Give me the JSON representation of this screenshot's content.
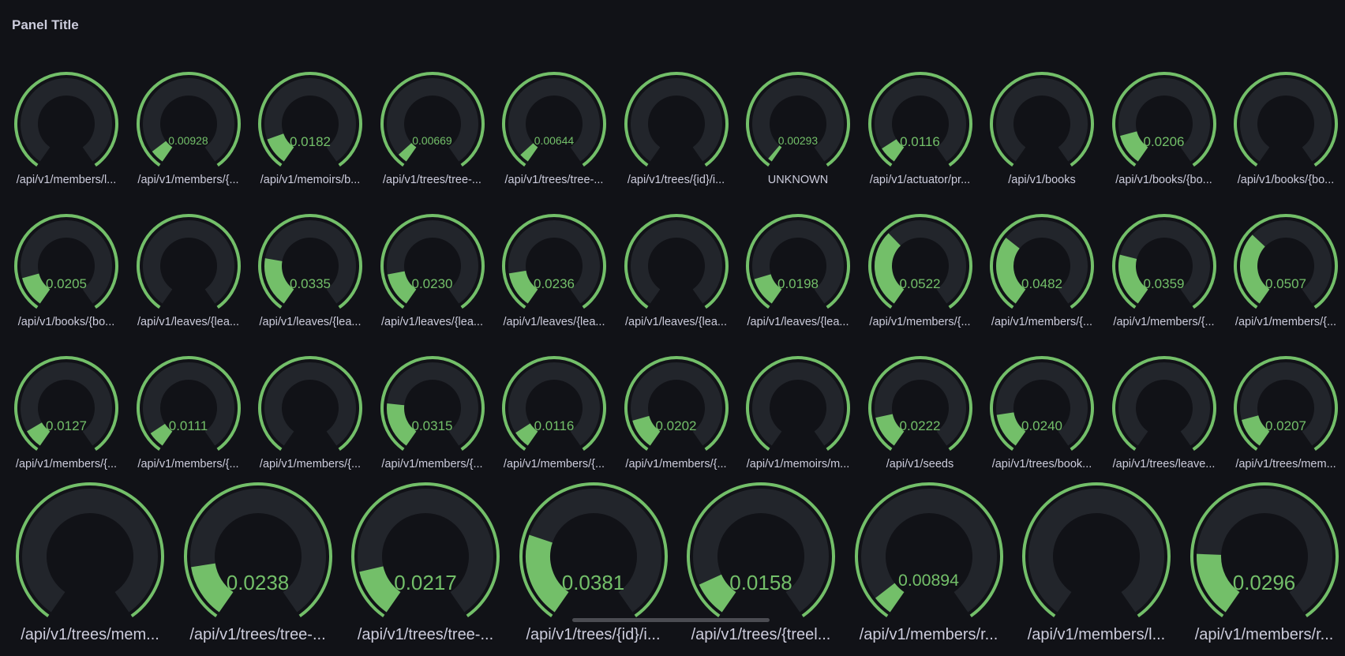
{
  "panel": {
    "title": "Panel Title"
  },
  "colors": {
    "background": "#111217",
    "track": "#22252b",
    "threshold": "#73bf69",
    "value": "#73bf69",
    "label": "#ccccdc"
  },
  "gauge_max": 0.15,
  "rows": [
    [
      {
        "label": "/api/v1/members/l...",
        "value": ""
      },
      {
        "label": "/api/v1/members/{...",
        "value": "0.00928"
      },
      {
        "label": "/api/v1/memoirs/b...",
        "value": "0.0182"
      },
      {
        "label": "/api/v1/trees/tree-...",
        "value": "0.00669"
      },
      {
        "label": "/api/v1/trees/tree-...",
        "value": "0.00644"
      },
      {
        "label": "/api/v1/trees/{id}/i...",
        "value": ""
      },
      {
        "label": "UNKNOWN",
        "value": "0.00293"
      },
      {
        "label": "/api/v1/actuator/pr...",
        "value": "0.0116"
      },
      {
        "label": "/api/v1/books",
        "value": ""
      },
      {
        "label": "/api/v1/books/{bo...",
        "value": "0.0206"
      },
      {
        "label": "/api/v1/books/{bo...",
        "value": ""
      }
    ],
    [
      {
        "label": "/api/v1/books/{bo...",
        "value": "0.0205"
      },
      {
        "label": "/api/v1/leaves/{lea...",
        "value": ""
      },
      {
        "label": "/api/v1/leaves/{lea...",
        "value": "0.0335"
      },
      {
        "label": "/api/v1/leaves/{lea...",
        "value": "0.0230"
      },
      {
        "label": "/api/v1/leaves/{lea...",
        "value": "0.0236"
      },
      {
        "label": "/api/v1/leaves/{lea...",
        "value": ""
      },
      {
        "label": "/api/v1/leaves/{lea...",
        "value": "0.0198"
      },
      {
        "label": "/api/v1/members/{...",
        "value": "0.0522"
      },
      {
        "label": "/api/v1/members/{...",
        "value": "0.0482"
      },
      {
        "label": "/api/v1/members/{...",
        "value": "0.0359"
      },
      {
        "label": "/api/v1/members/{...",
        "value": "0.0507"
      }
    ],
    [
      {
        "label": "/api/v1/members/{...",
        "value": "0.0127"
      },
      {
        "label": "/api/v1/members/{...",
        "value": "0.0111"
      },
      {
        "label": "/api/v1/members/{...",
        "value": ""
      },
      {
        "label": "/api/v1/members/{...",
        "value": "0.0315"
      },
      {
        "label": "/api/v1/members/{...",
        "value": "0.0116"
      },
      {
        "label": "/api/v1/members/{...",
        "value": "0.0202"
      },
      {
        "label": "/api/v1/memoirs/m...",
        "value": ""
      },
      {
        "label": "/api/v1/seeds",
        "value": "0.0222"
      },
      {
        "label": "/api/v1/trees/book...",
        "value": "0.0240"
      },
      {
        "label": "/api/v1/trees/leave...",
        "value": ""
      },
      {
        "label": "/api/v1/trees/mem...",
        "value": "0.0207"
      }
    ],
    [
      {
        "label": "/api/v1/trees/mem...",
        "value": ""
      },
      {
        "label": "/api/v1/trees/tree-...",
        "value": "0.0238"
      },
      {
        "label": "/api/v1/trees/tree-...",
        "value": "0.0217"
      },
      {
        "label": "/api/v1/trees/{id}/i...",
        "value": "0.0381"
      },
      {
        "label": "/api/v1/trees/{treel...",
        "value": "0.0158"
      },
      {
        "label": "/api/v1/members/r...",
        "value": "0.00894"
      },
      {
        "label": "/api/v1/members/l...",
        "value": ""
      },
      {
        "label": "/api/v1/members/r...",
        "value": "0.0296"
      }
    ]
  ]
}
